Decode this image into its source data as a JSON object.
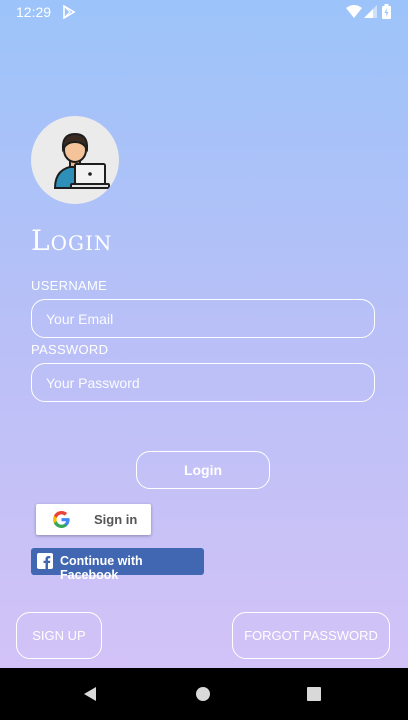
{
  "status_bar": {
    "time": "12:29",
    "app_icon": "play-store-icon",
    "wifi_icon": "wifi-icon",
    "signal_icon": "cell-signal-icon",
    "battery_icon": "battery-icon"
  },
  "header": {
    "avatar_icon": "user-laptop-avatar-icon",
    "title": "Login"
  },
  "form": {
    "username_label": "USERNAME",
    "username_placeholder": "Your Email",
    "password_label": "PASSWORD",
    "password_placeholder": "Your Password",
    "login_label": "Login"
  },
  "social": {
    "google_label": "Sign in",
    "google_icon": "google-g-icon",
    "facebook_label": "Continue with Facebook",
    "facebook_icon": "facebook-f-icon",
    "facebook_color": "#4267b2"
  },
  "footer": {
    "signup_label": "SIGN UP",
    "forgot_label": "FORGOT PASSWORD"
  },
  "nav_bar": {
    "back_icon": "back-triangle-icon",
    "home_icon": "home-circle-icon",
    "recent_icon": "recent-apps-square-icon"
  },
  "colors": {
    "gradient_top": "#9cc4fa",
    "gradient_bottom": "#d6c3f7",
    "foreground": "#ffffff"
  }
}
